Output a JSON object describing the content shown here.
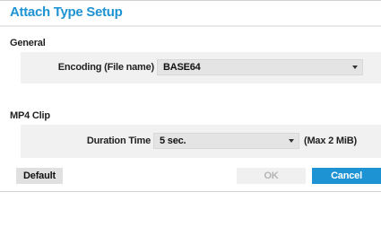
{
  "dialog": {
    "title": "Attach Type Setup"
  },
  "general": {
    "section_label": "General",
    "encoding_label": "Encoding (File name)",
    "encoding_value": "BASE64"
  },
  "mp4": {
    "section_label": "MP4 Clip",
    "duration_label": "Duration Time",
    "duration_value": "5 sec.",
    "duration_note": "(Max 2 MiB)"
  },
  "buttons": {
    "default_label": "Default",
    "ok_label": "OK",
    "cancel_label": "Cancel"
  },
  "colors": {
    "accent": "#1e93d3",
    "disabled_text": "#b5b5b5",
    "panel_bg": "#f1f1f1"
  },
  "icons": {
    "dropdown": "chevron-down-icon"
  }
}
